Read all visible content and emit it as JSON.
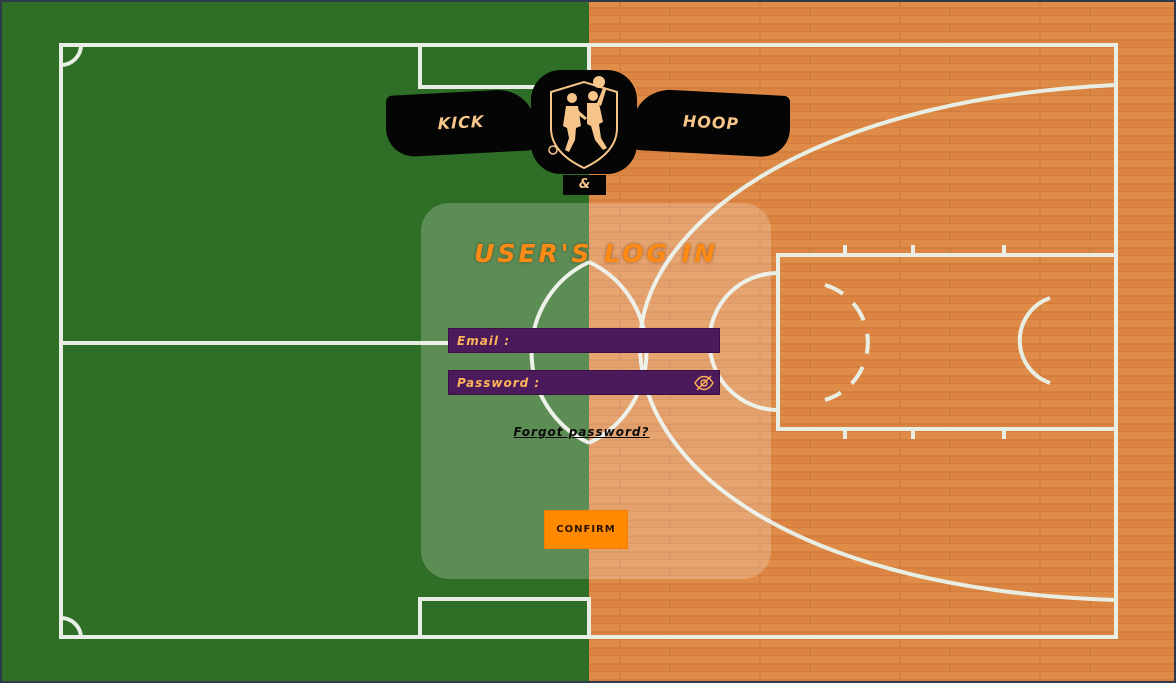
{
  "logo": {
    "left_text": "KICK",
    "right_text": "HOOP",
    "ampersand": "&",
    "emblem_icon": "soccer-basketball-players-icon"
  },
  "login": {
    "title": "USER'S LOG IN",
    "email": {
      "label": "Email :",
      "value": ""
    },
    "password": {
      "label": "Password :",
      "value": "",
      "toggle_icon": "eye-slash-icon"
    },
    "forgot_link": "Forgot password?",
    "confirm_label": "CONFIRM"
  },
  "colors": {
    "grass": "#2f6e26",
    "wood": "#d9803f",
    "accent": "#ff8a14",
    "field_bg": "#4a1a5a",
    "label": "#ffb35a",
    "logo_gold": "#f7c58a"
  }
}
